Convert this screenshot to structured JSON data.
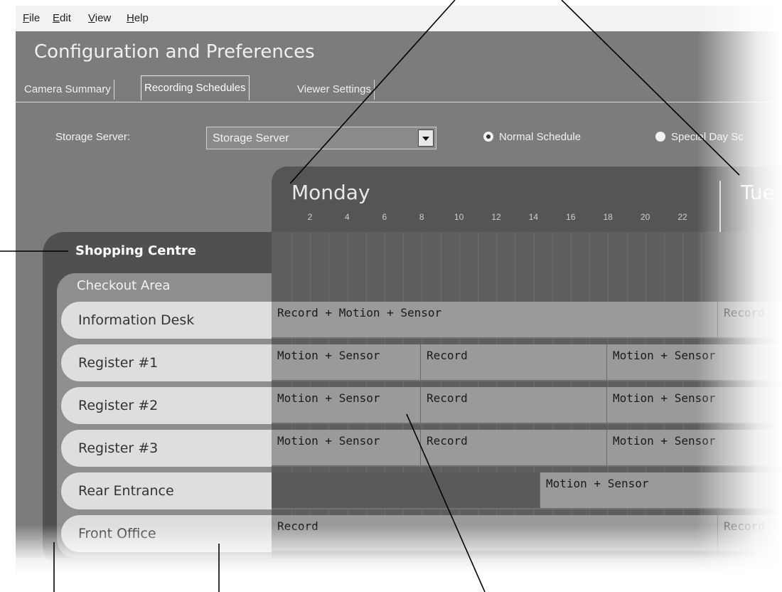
{
  "menu": [
    "File",
    "Edit",
    "View",
    "Help"
  ],
  "window_title": "Configuration and Preferences",
  "tabs": [
    {
      "label": "Camera Summary",
      "active": false
    },
    {
      "label": "Recording Schedules",
      "active": true
    },
    {
      "label": "Viewer Settings",
      "active": false
    }
  ],
  "storage": {
    "label": "Storage Server:",
    "value": "Storage Server"
  },
  "radios": {
    "normal": "Normal Schedule",
    "special": "Special Day Sc"
  },
  "days": {
    "monday": "Monday",
    "tuesday": "Tue"
  },
  "hours": [
    "2",
    "4",
    "6",
    "8",
    "10",
    "12",
    "14",
    "16",
    "18",
    "20",
    "22"
  ],
  "site": "Shopping Centre",
  "area": "Checkout Area",
  "cameras": [
    {
      "name": "Information Desk",
      "segments": [
        {
          "label": "Record + Motion + Sensor"
        },
        {
          "label": "Record"
        }
      ]
    },
    {
      "name": "Register #1",
      "segments": [
        {
          "label": "Motion + Sensor"
        },
        {
          "label": "Record"
        },
        {
          "label": "Motion + Sensor"
        }
      ]
    },
    {
      "name": "Register #2",
      "segments": [
        {
          "label": "Motion + Sensor"
        },
        {
          "label": "Record"
        },
        {
          "label": "Motion + Sensor"
        }
      ]
    },
    {
      "name": "Register #3",
      "segments": [
        {
          "label": "Motion + Sensor"
        },
        {
          "label": "Record"
        },
        {
          "label": "Motion + Sensor"
        }
      ]
    },
    {
      "name": "Rear Entrance",
      "segments": [
        {
          "label": ""
        },
        {
          "label": "Motion + Sensor"
        }
      ]
    },
    {
      "name": "Front Office",
      "segments": [
        {
          "label": "Record"
        },
        {
          "label": "Record"
        }
      ]
    }
  ]
}
